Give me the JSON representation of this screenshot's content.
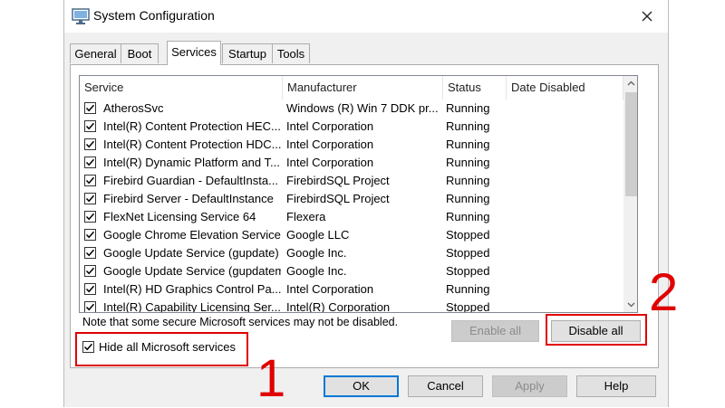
{
  "window": {
    "title": "System Configuration",
    "close_glyph": "✕"
  },
  "tabs": [
    "General",
    "Boot",
    "Services",
    "Startup",
    "Tools"
  ],
  "active_tab": "Services",
  "columns": [
    "Service",
    "Manufacturer",
    "Status",
    "Date Disabled"
  ],
  "rows": [
    {
      "service": "AtherosSvc",
      "manufacturer": "Windows (R) Win 7 DDK pr...",
      "status": "Running",
      "date_disabled": "",
      "checked": true
    },
    {
      "service": "Intel(R) Content Protection HEC...",
      "manufacturer": "Intel Corporation",
      "status": "Running",
      "date_disabled": "",
      "checked": true
    },
    {
      "service": "Intel(R) Content Protection HDC...",
      "manufacturer": "Intel Corporation",
      "status": "Running",
      "date_disabled": "",
      "checked": true
    },
    {
      "service": "Intel(R) Dynamic Platform and T...",
      "manufacturer": "Intel Corporation",
      "status": "Running",
      "date_disabled": "",
      "checked": true
    },
    {
      "service": "Firebird Guardian - DefaultInsta...",
      "manufacturer": "FirebirdSQL Project",
      "status": "Running",
      "date_disabled": "",
      "checked": true
    },
    {
      "service": "Firebird Server - DefaultInstance",
      "manufacturer": "FirebirdSQL Project",
      "status": "Running",
      "date_disabled": "",
      "checked": true
    },
    {
      "service": "FlexNet Licensing Service 64",
      "manufacturer": "Flexera",
      "status": "Running",
      "date_disabled": "",
      "checked": true
    },
    {
      "service": "Google Chrome Elevation Service",
      "manufacturer": "Google LLC",
      "status": "Stopped",
      "date_disabled": "",
      "checked": true
    },
    {
      "service": "Google Update Service (gupdate)",
      "manufacturer": "Google Inc.",
      "status": "Stopped",
      "date_disabled": "",
      "checked": true
    },
    {
      "service": "Google Update Service (gupdatem)",
      "manufacturer": "Google Inc.",
      "status": "Stopped",
      "date_disabled": "",
      "checked": true
    },
    {
      "service": "Intel(R) HD Graphics Control Pa...",
      "manufacturer": "Intel Corporation",
      "status": "Running",
      "date_disabled": "",
      "checked": true
    },
    {
      "service": "Intel(R) Capability Licensing Ser...",
      "manufacturer": "Intel(R) Corporation",
      "status": "Stopped",
      "date_disabled": "",
      "checked": true
    }
  ],
  "note": "Note that some secure Microsoft services may not be disabled.",
  "buttons": {
    "enable_all": "Enable all",
    "disable_all": "Disable all",
    "ok": "OK",
    "cancel": "Cancel",
    "apply": "Apply",
    "help": "Help"
  },
  "hide_ms": {
    "label": "Hide all Microsoft services",
    "checked": true
  },
  "annotations": {
    "one": "1",
    "two": "2",
    "color": "#e00000"
  },
  "icons": {
    "app": "system-configuration-icon",
    "close": "close-icon",
    "check": "checkmark-icon",
    "scroll_up": "chevron-up-icon",
    "scroll_down": "chevron-down-icon"
  },
  "colors": {
    "window_bg": "#f0f0f0",
    "list_border": "#828790",
    "default_button_border": "#0078d7"
  }
}
